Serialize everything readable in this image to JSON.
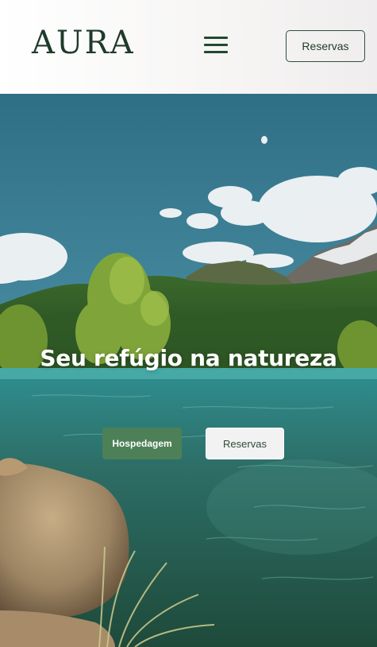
{
  "header": {
    "logo_text": "AURA",
    "menu_icon": "hamburger-menu-icon",
    "cta_label": "Reservas"
  },
  "hero": {
    "title": "Seu refúgio na natureza",
    "primary_button": "Hospedagem",
    "secondary_button": "Reservas",
    "image_subject": "mountain-lake-landscape-image"
  },
  "colors": {
    "brand_dark_green": "#1f3a2b",
    "button_green": "#4d8056",
    "button_light": "#f2f2f2"
  }
}
